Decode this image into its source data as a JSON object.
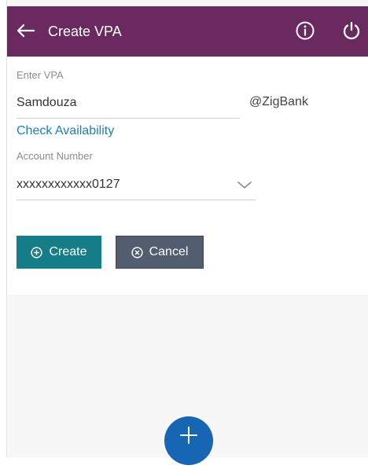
{
  "header": {
    "title": "Create VPA",
    "bg_color": "#6b2a5f"
  },
  "form": {
    "vpa_label": "Enter VPA",
    "vpa_value": "Samdouza",
    "vpa_suffix": "@ZigBank",
    "check_availability": "Check Availability",
    "account_label": "Account Number",
    "account_value": "xxxxxxxxxxxx0127"
  },
  "actions": {
    "create_label": "Create",
    "cancel_label": "Cancel",
    "create_color": "#147d87",
    "cancel_color": "#525d6f"
  },
  "fab": {
    "icon": "plus-icon",
    "color": "#1766b4"
  },
  "icons": {
    "back": "arrow-left-icon",
    "info": "info-icon",
    "power": "power-icon",
    "dropdown": "chevron-down-icon"
  }
}
